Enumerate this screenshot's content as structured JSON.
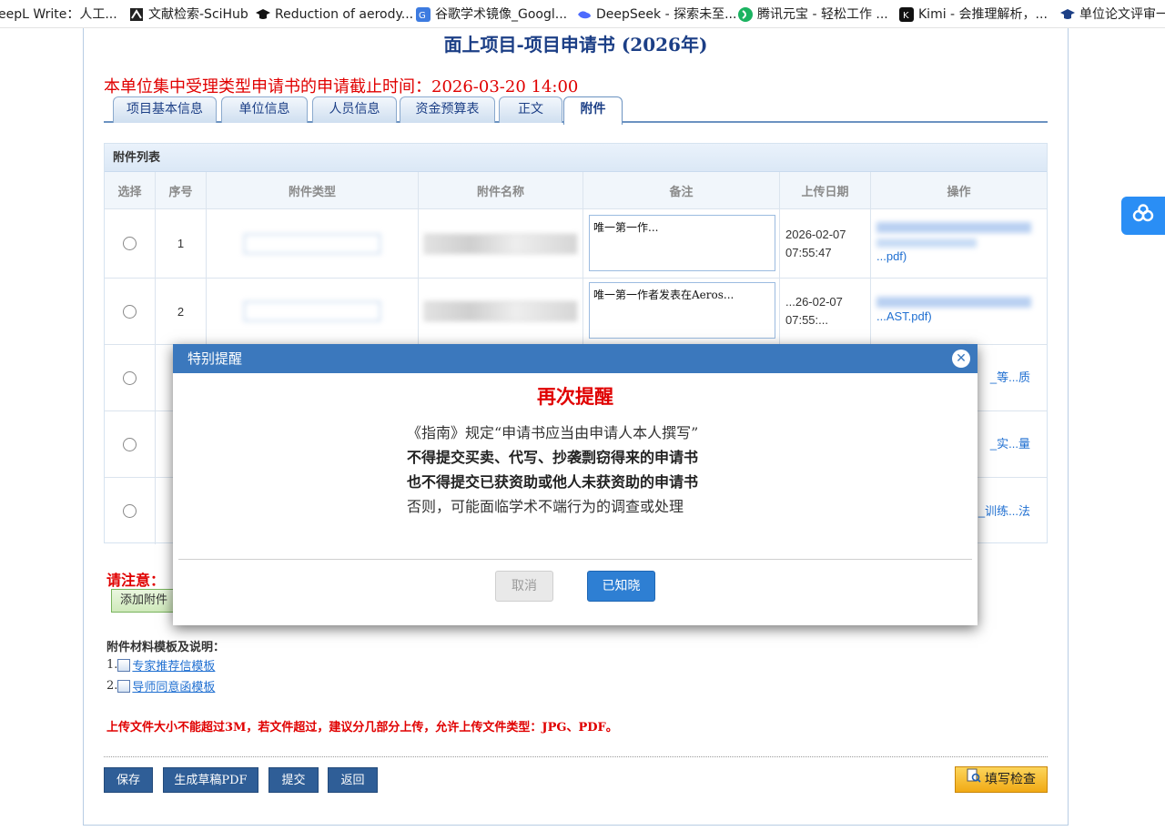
{
  "bookmarks": [
    {
      "label": "eepL Write：人工..."
    },
    {
      "label": "文献检索-SciHub"
    },
    {
      "label": "Reduction of aerody..."
    },
    {
      "label": "谷歌学术镜像_Googl..."
    },
    {
      "label": "DeepSeek - 探索未至..."
    },
    {
      "label": "腾讯元宝 - 轻松工作 ..."
    },
    {
      "label": "Kimi - 会推理解析，..."
    },
    {
      "label": "单位论文评审一"
    }
  ],
  "page": {
    "title": "面上项目-项目申请书 (2026年)",
    "deadline": "本单位集中受理类型申请书的申请截止时间：2026-03-20 14:00"
  },
  "tabs": [
    {
      "label": "项目基本信息",
      "active": false
    },
    {
      "label": "单位信息",
      "active": false
    },
    {
      "label": "人员信息",
      "active": false
    },
    {
      "label": "资金预算表",
      "active": false
    },
    {
      "label": "正文",
      "active": false
    },
    {
      "label": "附件",
      "active": true
    }
  ],
  "attachments": {
    "heading": "附件列表",
    "columns": [
      "选择",
      "序号",
      "附件类型",
      "附件名称",
      "备注",
      "上传日期",
      "操作"
    ],
    "rows": [
      {
        "seq": "1",
        "remark": "唯一第一作...",
        "date_line1": "2026-02-07",
        "date_line2": "07:55:47",
        "op_line": "...pdf)"
      },
      {
        "seq": "2",
        "remark": "唯一第一作者发表在Aeros...",
        "date_line1": "...26-02-07",
        "date_line2": "07:55:...",
        "op_line": "...AST.pdf)"
      },
      {
        "seq": "",
        "remark": "",
        "date_line1": "",
        "date_line2": "",
        "op_line": "_等...质"
      },
      {
        "seq": "",
        "remark": "",
        "date_line1": "",
        "date_line2": "",
        "op_line": "_实...量"
      },
      {
        "seq": "",
        "remark": "",
        "date_line1": "",
        "date_line2": "",
        "op_line": "_训练...法"
      }
    ]
  },
  "notes": {
    "notice_label": "请注意：",
    "add_button": "添加附件",
    "templates_title": "附件材料模板及说明：",
    "templates": [
      {
        "index": "1.",
        "label": "专家推荐信模板"
      },
      {
        "index": "2.",
        "label": "导师同意函模板"
      }
    ],
    "upload_note": "上传文件大小不能超过3M，若文件超过，建议分几部分上传，允许上传文件类型：JPG、PDF。"
  },
  "actions": {
    "save": "保存",
    "pdf": "生成草稿PDF",
    "submit": "提交",
    "back": "返回",
    "check": "填写检查"
  },
  "modal": {
    "header": "特别提醒",
    "title": "再次提醒",
    "lines": [
      "《指南》规定“申请书应当由申请人本人撰写”",
      "不得提交买卖、代写、抄袭剽窃得来的申请书",
      "也不得提交已获资助或他人未获资助的申请书",
      "否则，可能面临学术不端行为的调查或处理"
    ],
    "cancel": "取消",
    "ok": "已知晓"
  },
  "colors": {
    "brand_blue": "#3b78bd",
    "alert_red": "#e00000",
    "link_blue": "#1f6fd1"
  }
}
